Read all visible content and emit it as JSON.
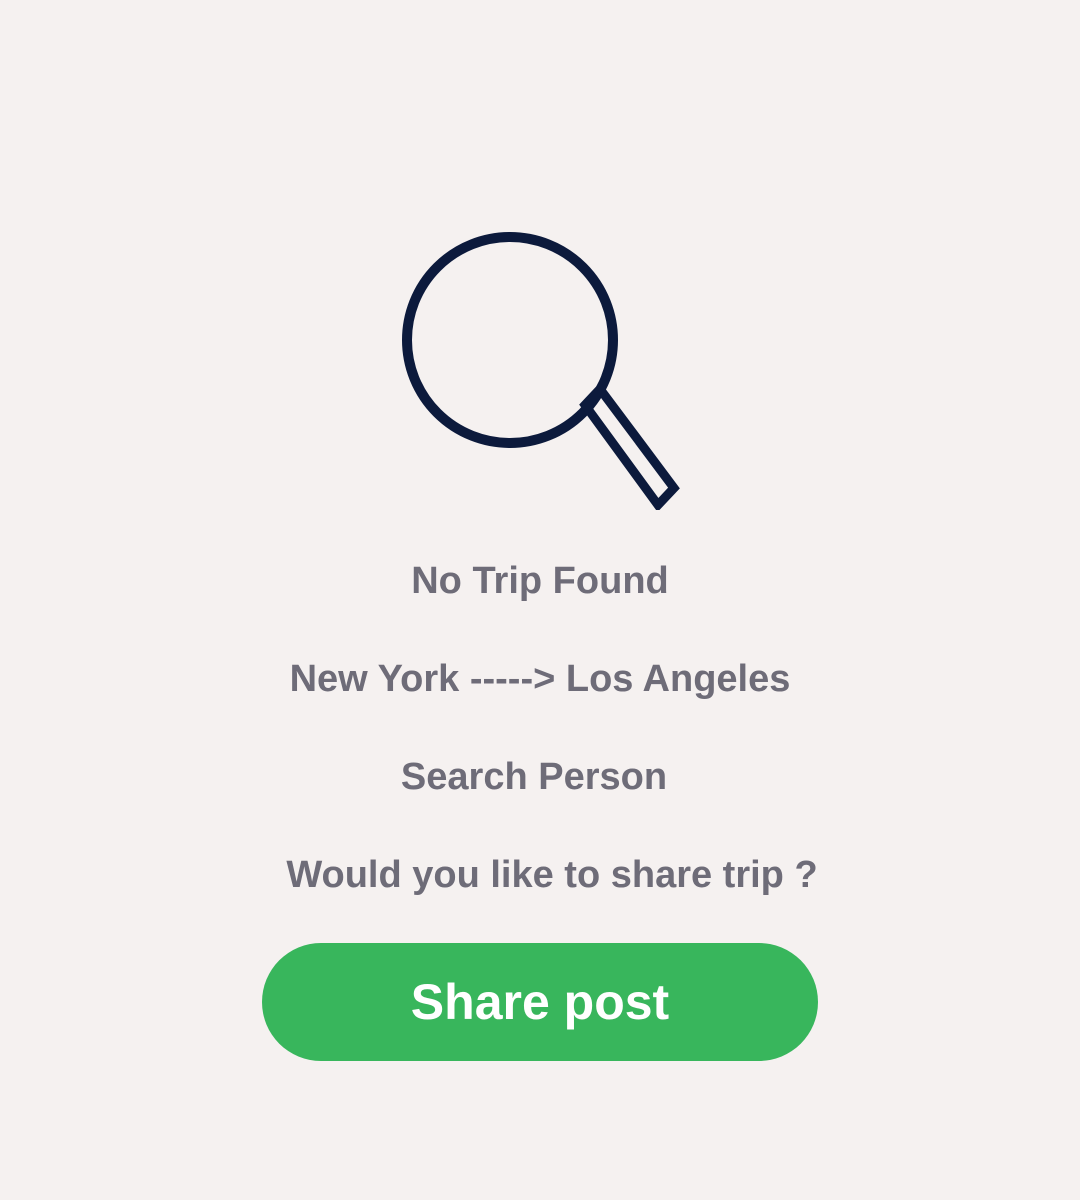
{
  "empty_state": {
    "icon": "search-icon",
    "icon_color": "#0c1a3c",
    "title": "No Trip Found",
    "route": "New York -----> Los Angeles",
    "search_label": "Search Person",
    "share_prompt": "Would you like to share trip ?"
  },
  "actions": {
    "share_label": "Share post",
    "share_color": "#38b65c"
  }
}
